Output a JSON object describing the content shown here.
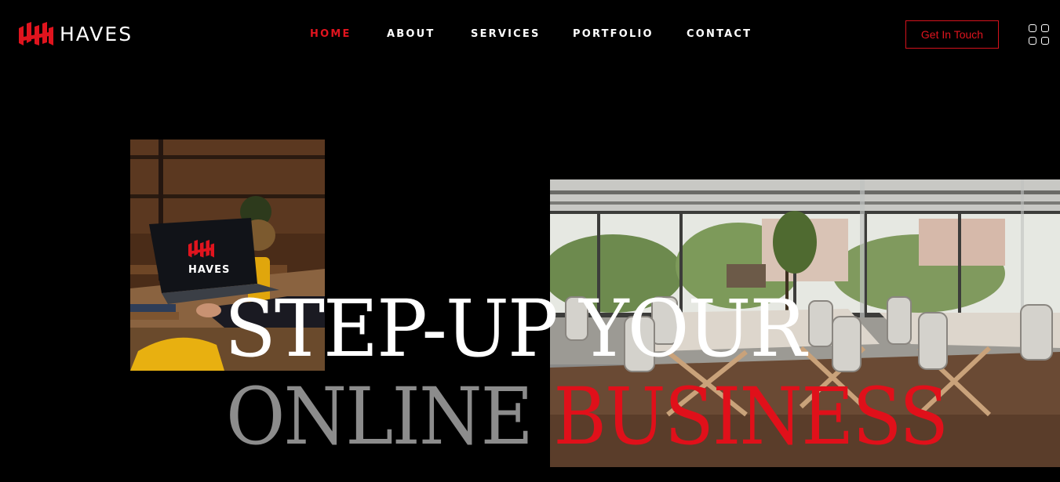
{
  "brand": {
    "name": "HAVES",
    "logo_icon": "haves-logo-mark",
    "accent_color": "#e0141e"
  },
  "nav": {
    "items": [
      {
        "label": "HOME",
        "active": true
      },
      {
        "label": "ABOUT",
        "active": false
      },
      {
        "label": "SERVICES",
        "active": false
      },
      {
        "label": "PORTFOLIO",
        "active": false
      },
      {
        "label": "CONTACT",
        "active": false
      }
    ]
  },
  "header": {
    "cta_label": "Get In Touch",
    "menu_icon": "grid-menu-icon"
  },
  "hero": {
    "line1": "STEP-UP YOUR",
    "line2_grey": "ONLINE",
    "line2_red": "BUSINESS",
    "laptop_logo_text": "HAVES",
    "images": [
      "laptop-workspace-photo",
      "conference-room-photo"
    ]
  }
}
